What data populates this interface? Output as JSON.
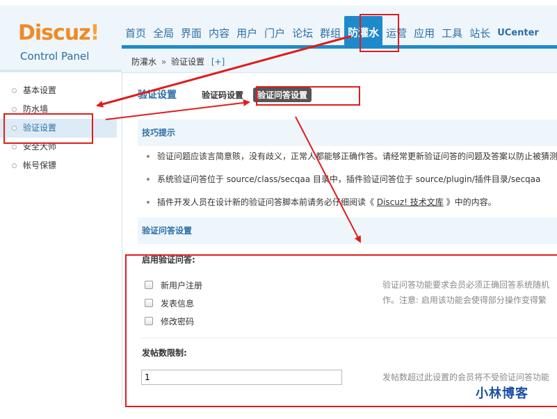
{
  "logo": {
    "name": "Discuz",
    "bang": "!",
    "subtitle": "Control Panel"
  },
  "top_nav": {
    "items": [
      {
        "label": "首页"
      },
      {
        "label": "全局"
      },
      {
        "label": "界面"
      },
      {
        "label": "内容"
      },
      {
        "label": "用户"
      },
      {
        "label": "门户"
      },
      {
        "label": "论坛"
      },
      {
        "label": "群组"
      },
      {
        "label": "防灌水",
        "active": true
      },
      {
        "label": "运营"
      },
      {
        "label": "应用"
      },
      {
        "label": "工具"
      },
      {
        "label": "站长"
      },
      {
        "label": "UCenter"
      }
    ]
  },
  "breadcrumb": {
    "section": "防灌水",
    "separator": "»",
    "page": "验证设置",
    "add": "[+]"
  },
  "sidebar": {
    "items": [
      {
        "label": "基本设置"
      },
      {
        "label": "防水墙"
      },
      {
        "label": "验证设置",
        "active": true
      },
      {
        "label": "安全大师"
      },
      {
        "label": "帐号保镖"
      }
    ]
  },
  "main": {
    "title": "验证设置",
    "subtabs": [
      {
        "label": "验证码设置"
      },
      {
        "label": "验证问答设置",
        "current": true
      }
    ],
    "tips": {
      "heading": "技巧提示",
      "items": [
        {
          "text": "验证问题应该言简意赅，没有歧义，正常人都能够正确作答。请经常更新验证问答的问题及答案以防止被猜测"
        },
        {
          "text": "系统验证问答位于 source/class/secqaa 目录中，插件验证问答位于 source/plugin/插件目录/secqaa"
        },
        {
          "text_before": "插件开发人员在设计新的验证问答脚本前请务必仔细阅读《 ",
          "link": "Discuz! 技术文库",
          "text_after": " 》中的内容。"
        }
      ]
    },
    "qa_section": {
      "heading": "验证问答设置",
      "enable_label": "启用验证问答:",
      "options": [
        {
          "label": "新用户注册",
          "checked": false
        },
        {
          "label": "发表信息",
          "checked": false
        },
        {
          "label": "修改密码",
          "checked": false
        }
      ],
      "enable_desc_line1": "验证问答功能要求会员必须正确回答系统随机",
      "enable_desc_line2": "作。注意: 启用该功能会使得部分操作变得繁",
      "post_limit_label": "发帖数限制:",
      "post_limit_value": "1",
      "post_limit_desc": "发帖数超过此设置的会员将不受验证问答功能"
    }
  },
  "watermark": "小林博客",
  "colors": {
    "accent_blue": "#1f8acb",
    "link_blue": "#2b6ea6",
    "annotation_red": "#e11b1b",
    "logo_orange": "#f08a24"
  }
}
